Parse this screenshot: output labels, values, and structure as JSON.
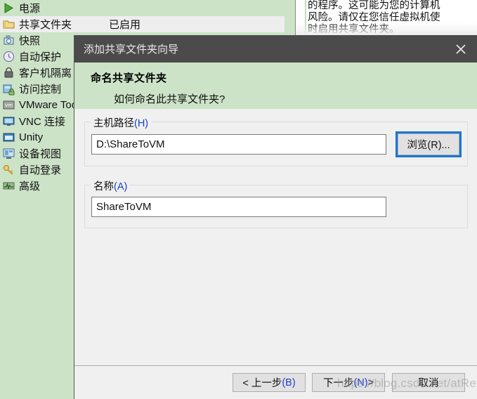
{
  "background": {
    "settings_list": {
      "status_column_label": "已启用",
      "items": [
        {
          "label": "电源",
          "icon": "power-play-icon",
          "status": "",
          "selected": false
        },
        {
          "label": "共享文件夹",
          "icon": "folder-icon",
          "status": "已启用",
          "selected": true
        },
        {
          "label": "快照",
          "icon": "snapshot-camera-icon",
          "status": "",
          "selected": false
        },
        {
          "label": "自动保护",
          "icon": "autoprotect-clock-icon",
          "status": "",
          "selected": false
        },
        {
          "label": "客户机隔离",
          "icon": "lock-icon",
          "status": "",
          "selected": false
        },
        {
          "label": "访问控制",
          "icon": "access-control-lock-icon",
          "status": "",
          "selected": false
        },
        {
          "label": "VMware Tools",
          "icon": "vmware-tools-icon",
          "status": "",
          "selected": false
        },
        {
          "label": "VNC 连接",
          "icon": "monitor-vnc-icon",
          "status": "",
          "selected": false
        },
        {
          "label": "Unity",
          "icon": "unity-window-icon",
          "status": "",
          "selected": false
        },
        {
          "label": "设备视图",
          "icon": "device-view-icon",
          "status": "",
          "selected": false
        },
        {
          "label": "自动登录",
          "icon": "key-autologin-icon",
          "status": "",
          "selected": false
        },
        {
          "label": "高级",
          "icon": "advanced-waveform-icon",
          "status": "",
          "selected": false
        }
      ]
    },
    "info_panel": {
      "lines": [
        "的程序。这可能为您的计算机",
        "风险。请仅在您信任虚拟机使",
        "时启用共享文件夹。"
      ]
    }
  },
  "dialog": {
    "title": "添加共享文件夹向导",
    "close_icon": "close-icon",
    "header": {
      "heading": "命名共享文件夹",
      "subheading": "如何命名此共享文件夹?"
    },
    "host_path_group": {
      "legend": "主机路径",
      "legend_accel": "(H)",
      "value": "D:\\ShareToVM",
      "placeholder": ""
    },
    "browse_button": {
      "label": "浏览(R)...",
      "focused": true,
      "focus_color": "#1976d2"
    },
    "name_group": {
      "legend": "名称",
      "legend_accel": "(A)",
      "value": "ShareToVM",
      "placeholder": ""
    },
    "footer_buttons": [
      {
        "id": "back",
        "text": "< 上一步",
        "accel": "(B)"
      },
      {
        "id": "next",
        "text": "下一步",
        "accel": "(N)",
        "suffix": " >"
      },
      {
        "id": "cancel",
        "text": "取消",
        "accel": ""
      }
    ]
  },
  "watermark": {
    "text": "https://blog.csdn.net/atRex"
  },
  "colors": {
    "app_background": "#cde3c8",
    "dialog_background": "#f0f0f0",
    "titlebar": "#4b4b4b",
    "header_band": "#cde3c8",
    "accent_blue": "#1a3fd0",
    "focus_blue": "#1976d2"
  }
}
